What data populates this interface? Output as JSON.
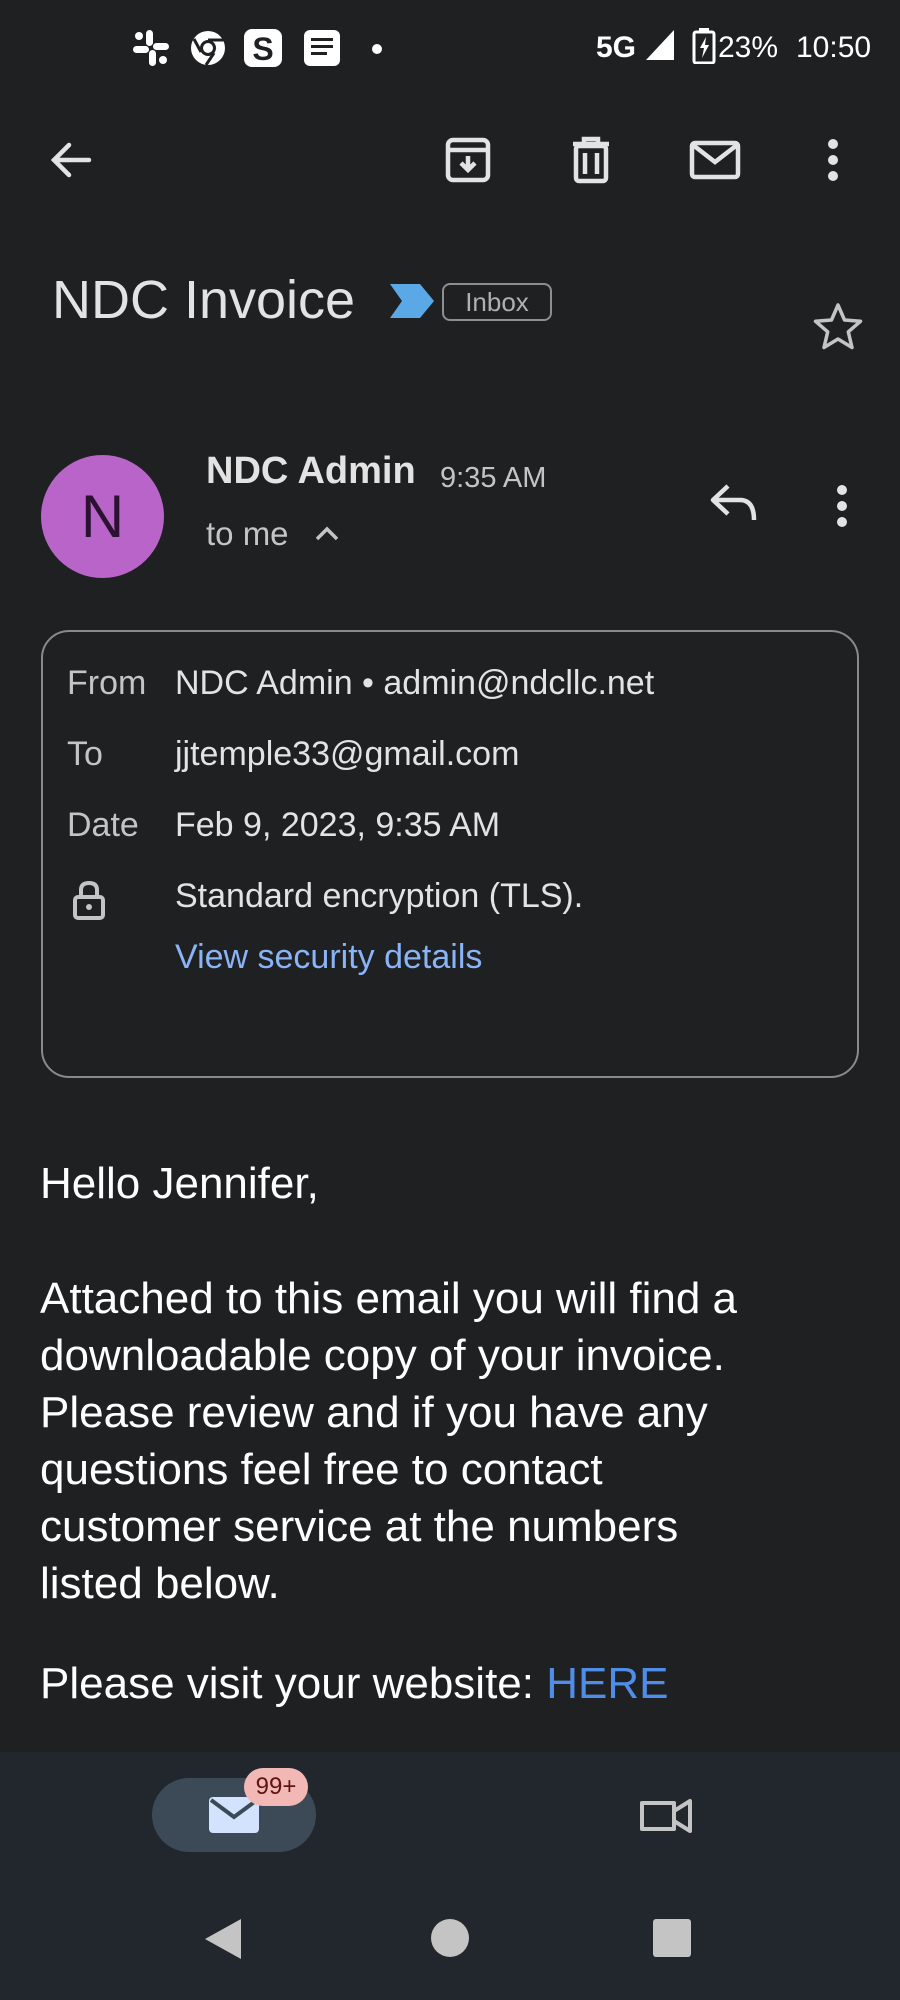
{
  "status_bar": {
    "icons": [
      "slack-icon",
      "chrome-icon",
      "s-app-icon",
      "message-icon",
      "dot"
    ],
    "network": "5G",
    "battery": "23%",
    "time": "10:50"
  },
  "toolbar": {
    "icons": [
      "back-arrow-icon",
      "archive-icon",
      "delete-icon",
      "mark-unread-icon",
      "more-vert-icon"
    ]
  },
  "email": {
    "subject": "NDC Invoice",
    "label": "Inbox",
    "sender_initial": "N",
    "sender_name": "NDC Admin",
    "time": "9:35 AM",
    "recipient_summary": "to me"
  },
  "details": {
    "from_label": "From",
    "from_value": "NDC Admin • admin@ndcllc.net",
    "to_label": "To",
    "to_value": "jjtemple33@gmail.com",
    "date_label": "Date",
    "date_value": "Feb 9, 2023, 9:35 AM",
    "encryption": "Standard encryption (TLS).",
    "security_link": "View security details"
  },
  "body": {
    "greeting": "Hello Jennifer,",
    "lines": [
      "Attached to this email you will find a",
      "downloadable copy of your invoice.",
      "Please review and if you have any",
      "questions feel free to contact",
      "customer service at the numbers",
      "listed below."
    ],
    "visit_text": "Please visit your website: ",
    "visit_link": "HERE"
  },
  "bottom_nav": {
    "mail_badge": "99+"
  },
  "colors": {
    "background": "#1f2022",
    "avatar": "#b964c9",
    "link": "#8ab4f8",
    "here_link": "#4f8de8",
    "badge": "#f2b8b5"
  }
}
